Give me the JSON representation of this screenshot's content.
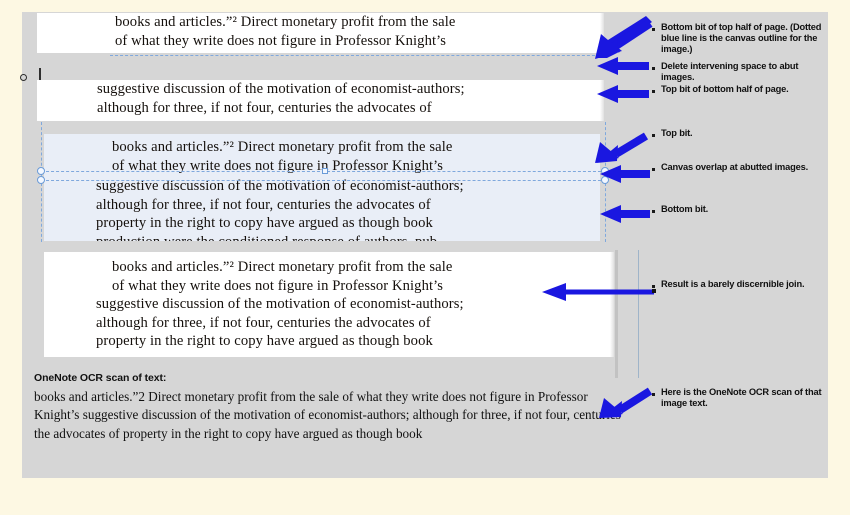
{
  "document": {
    "scan_lines": {
      "l1": "books and articles.”²   Direct monetary profit from the sale",
      "l2": "of what they write does not figure in Professor Knight’s",
      "l3": "suggestive discussion of the motivation of economist-authors;",
      "l4": "although for three, if not four, centuries the advocates of",
      "l5": "property in the right to copy have argued as though book",
      "l6": "production were the conditioned response of authors, pub-"
    }
  },
  "annotations": [
    {
      "id": "ann-1",
      "text": "Bottom bit of top half of page. (Dotted blue line is the canvas outline for the image.)"
    },
    {
      "id": "ann-2",
      "text": "Delete intervening space to abut images."
    },
    {
      "id": "ann-3",
      "text": "Top bit of bottom half of page."
    },
    {
      "id": "ann-4",
      "text": "Top bit."
    },
    {
      "id": "ann-5",
      "text": "Canvas overlap at abutted images."
    },
    {
      "id": "ann-6",
      "text": "Bottom bit."
    },
    {
      "id": "ann-7",
      "text": "Result is a  barely discernible join."
    },
    {
      "id": "ann-8",
      "text": "Here is the OneNote OCR scan of that image text."
    }
  ],
  "ocr_section": {
    "heading": "OneNote OCR scan of text:",
    "body": "books and articles.”2 Direct monetary  profit from  the  sale of what they  write does not figure in Professor Knight’s  suggestive  discussion of the  motivation  of economist-authors;  although  for three,  if not four,  centuries  the advocates of property in the  right to copy have argued as though  book"
  },
  "colors": {
    "page_background": "#fdf8e3",
    "panel_background": "#d6d6d6",
    "scan_background": "#ffffff",
    "selected_scan_background": "#e9eef7",
    "canvas_outline": "#7fa8dd",
    "arrow": "#1a17e0",
    "annotation_text": "#111111"
  }
}
